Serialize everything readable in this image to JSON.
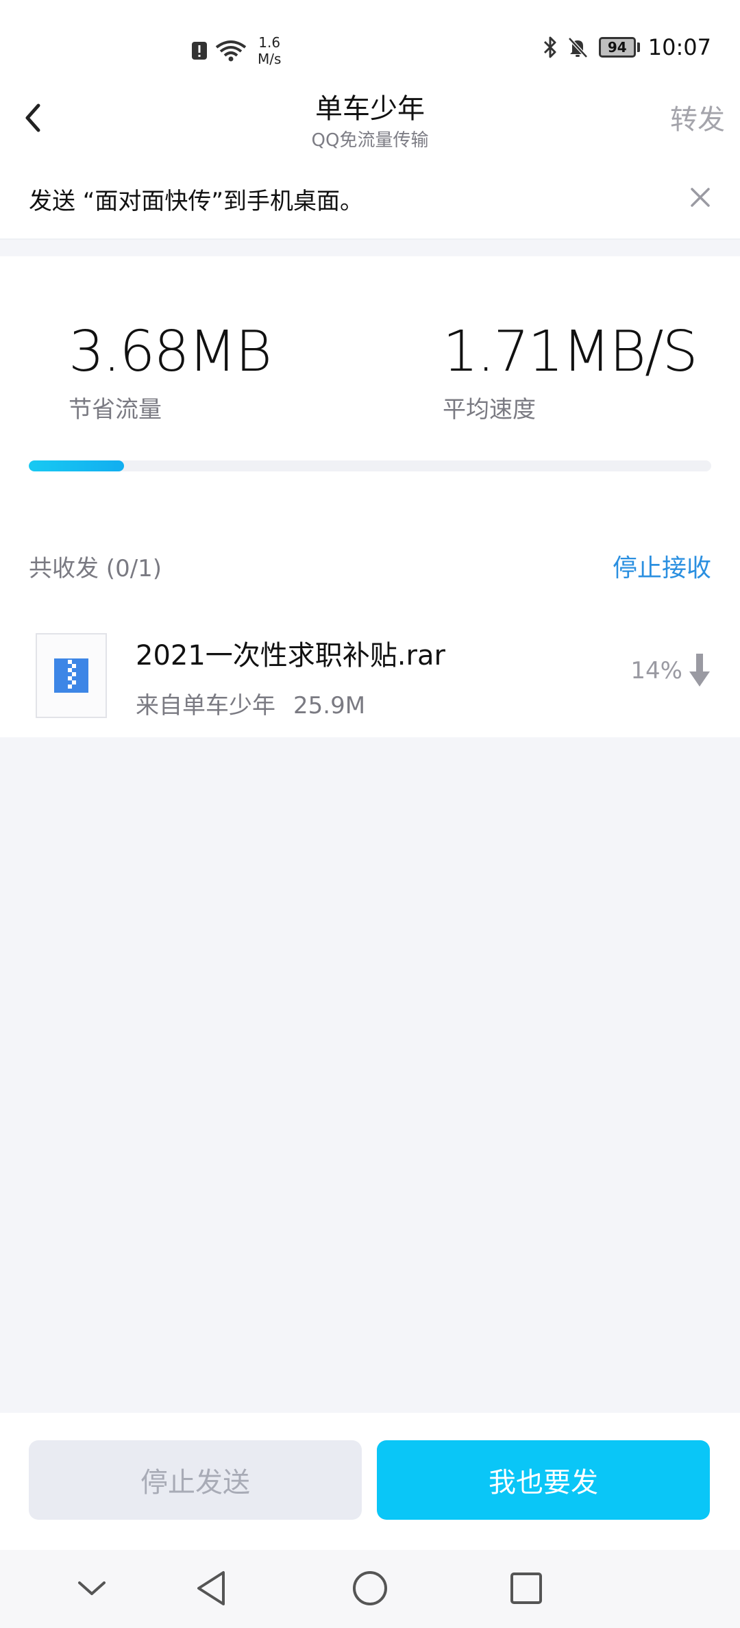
{
  "status_bar": {
    "net_speed_value": "1.6",
    "net_speed_unit": "M/s",
    "battery": "94",
    "time": "10:07"
  },
  "header": {
    "title": "单车少年",
    "subtitle": "QQ免流量传输",
    "forward_label": "转发"
  },
  "tip": {
    "text": "发送 “面对面快传”到手机桌面。"
  },
  "stats": {
    "saved_value": "3.68MB",
    "saved_label": "节省流量",
    "speed_value": "1.71MB/S",
    "speed_label": "平均速度",
    "overall_progress_percent": 14
  },
  "transfer": {
    "count_label": "共收发 (0/1)",
    "stop_receive_label": "停止接收",
    "files": [
      {
        "name": "2021一次性求职补贴.rar",
        "source": "来自单车少年",
        "size": "25.9M",
        "percent": "14%"
      }
    ]
  },
  "actions": {
    "stop_send_label": "停止发送",
    "also_send_label": "我也要发"
  },
  "colors": {
    "accent": "#0ac6f7",
    "link": "#2a8fe0",
    "background": "#f4f5f9"
  }
}
